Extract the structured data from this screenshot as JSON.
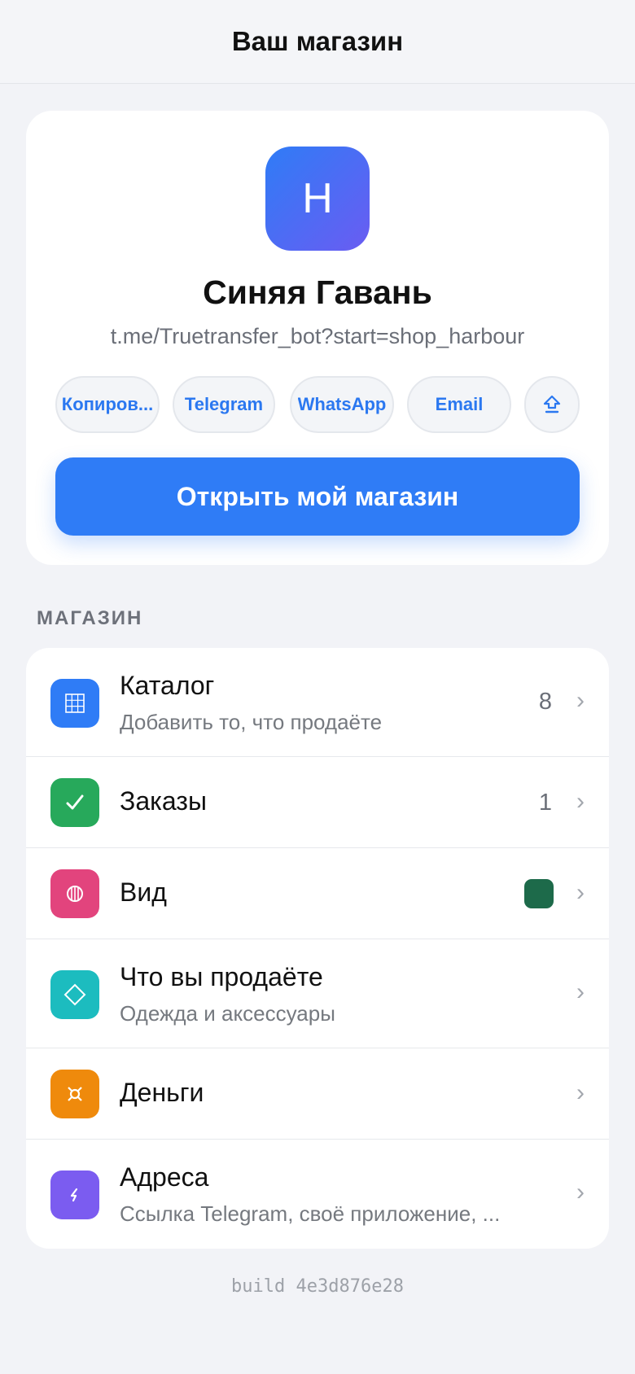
{
  "header": {
    "title": "Ваш магазин"
  },
  "shop": {
    "logo_letter": "H",
    "name": "Синяя Гавань",
    "link": "t.me/Truetransfer_bot?start=shop_harbour",
    "share": {
      "copy_label": "Копиров...",
      "telegram_label": "Telegram",
      "whatsapp_label": "WhatsApp",
      "email_label": "Email"
    },
    "open_label": "Открыть мой магазин"
  },
  "section": {
    "title": "МАГАЗИН"
  },
  "items": [
    {
      "title": "Каталог",
      "subtitle": "Добавить то, что продаёте",
      "count": "8",
      "icon": "grid-icon",
      "color": "#2f7cf6"
    },
    {
      "title": "Заказы",
      "count": "1",
      "icon": "check-icon",
      "color": "#27a95b"
    },
    {
      "title": "Вид",
      "icon": "palette-icon",
      "color": "#e2447d",
      "swatch": "#1d6a4a"
    },
    {
      "title": "Что вы продаёте",
      "subtitle": "Одежда и аксессуары",
      "icon": "diamond-icon",
      "color": "#1cbcbf"
    },
    {
      "title": "Деньги",
      "icon": "currency-icon",
      "color": "#ef8a0c"
    },
    {
      "title": "Адреса",
      "subtitle": "Ссылка Telegram, своё приложение, ...",
      "icon": "link-icon",
      "color": "#7b5cf0"
    }
  ],
  "footer": {
    "build": "build 4e3d876e28"
  }
}
